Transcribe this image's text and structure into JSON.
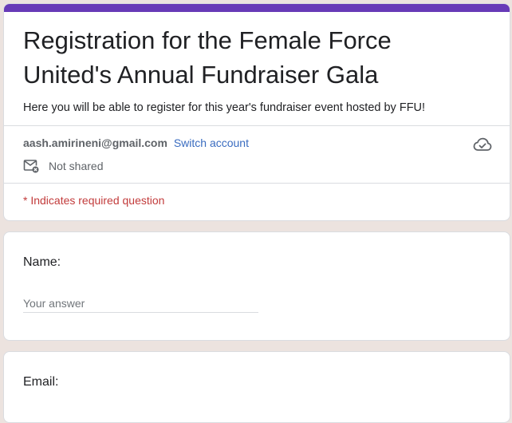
{
  "form": {
    "title": "Registration for the Female Force United's Annual Fundraiser Gala",
    "description": "Here you will be able to register for this year's fundraiser event hosted by FFU!",
    "account_email": "aash.amirineni@gmail.com",
    "switch_account_label": "Switch account",
    "not_shared_label": "Not shared",
    "required_note": "* Indicates required question",
    "cloud_status_icon": "cloud-check-icon",
    "not_shared_icon": "mail-off-icon"
  },
  "questions": [
    {
      "label": "Name:",
      "placeholder": "Your answer"
    },
    {
      "label": "Email:"
    }
  ],
  "colors": {
    "accent": "#673ab7",
    "background": "#ece3df",
    "link": "#3a6cc0",
    "required": "#c23b3b"
  }
}
